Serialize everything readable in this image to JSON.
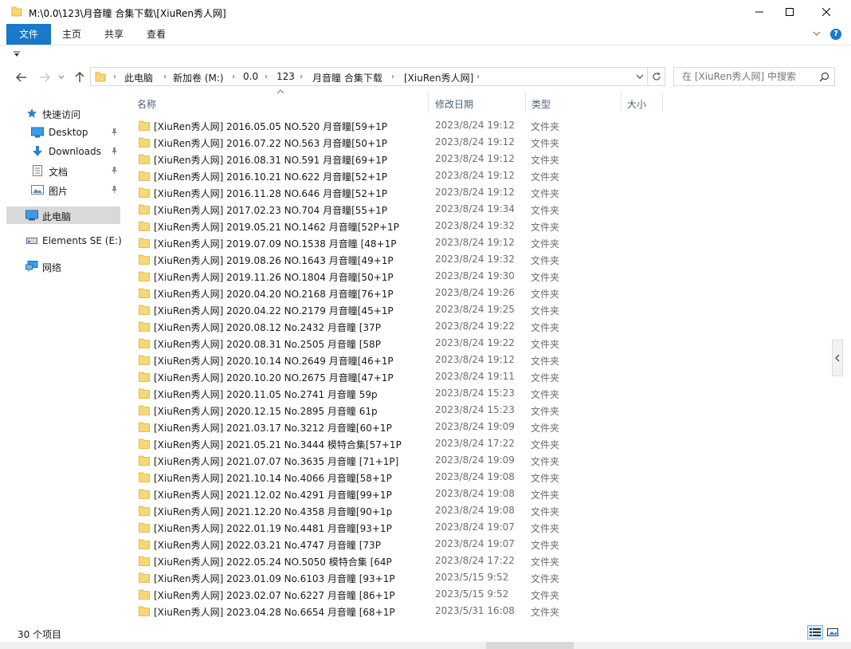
{
  "window": {
    "title": "M:\\0.0\\123\\月音瞳 合集下载\\[XiuRen秀人网]"
  },
  "ribbon": {
    "tabs": [
      "文件",
      "主页",
      "共享",
      "查看"
    ]
  },
  "address": {
    "crumbs": [
      "此电脑",
      "新加卷 (M:)",
      "0.0",
      "123",
      "月音瞳 合集下载",
      "[XiuRen秀人网]"
    ]
  },
  "search": {
    "placeholder": "在 [XiuRen秀人网] 中搜索"
  },
  "navpane": {
    "quick_access": "快速访问",
    "quick_items": [
      "Desktop",
      "Downloads",
      "文档",
      "图片"
    ],
    "this_pc": "此电脑",
    "drive": "Elements SE (E:)",
    "network": "网络"
  },
  "columns": {
    "name": "名称",
    "modified": "修改日期",
    "type": "类型",
    "size": "大小"
  },
  "files": [
    {
      "name": "[XiuRen秀人网] 2016.05.05 NO.520 月音瞳[59+1P",
      "date": "2023/8/24 19:12",
      "type": "文件夹"
    },
    {
      "name": "[XiuRen秀人网] 2016.07.22 NO.563 月音瞳[50+1P",
      "date": "2023/8/24 19:12",
      "type": "文件夹"
    },
    {
      "name": "[XiuRen秀人网] 2016.08.31 NO.591 月音瞳[69+1P",
      "date": "2023/8/24 19:12",
      "type": "文件夹"
    },
    {
      "name": "[XiuRen秀人网] 2016.10.21 NO.622 月音瞳[52+1P",
      "date": "2023/8/24 19:12",
      "type": "文件夹"
    },
    {
      "name": "[XiuRen秀人网] 2016.11.28 NO.646 月音瞳[52+1P",
      "date": "2023/8/24 19:12",
      "type": "文件夹"
    },
    {
      "name": "[XiuRen秀人网] 2017.02.23 NO.704 月音瞳[55+1P",
      "date": "2023/8/24 19:34",
      "type": "文件夹"
    },
    {
      "name": "[XiuRen秀人网] 2019.05.21 NO.1462 月音瞳[52P+1P",
      "date": "2023/8/24 19:32",
      "type": "文件夹"
    },
    {
      "name": "[XiuRen秀人网] 2019.07.09 NO.1538 月音瞳 [48+1P",
      "date": "2023/8/24 19:12",
      "type": "文件夹"
    },
    {
      "name": "[XiuRen秀人网] 2019.08.26 NO.1643 月音瞳[49+1P",
      "date": "2023/8/24 19:32",
      "type": "文件夹"
    },
    {
      "name": "[XiuRen秀人网] 2019.11.26 NO.1804 月音瞳[50+1P",
      "date": "2023/8/24 19:30",
      "type": "文件夹"
    },
    {
      "name": "[XiuRen秀人网] 2020.04.20 NO.2168 月音瞳[76+1P",
      "date": "2023/8/24 19:26",
      "type": "文件夹"
    },
    {
      "name": "[XiuRen秀人网] 2020.04.22 NO.2179 月音瞳[45+1P",
      "date": "2023/8/24 19:25",
      "type": "文件夹"
    },
    {
      "name": "[XiuRen秀人网] 2020.08.12 No.2432 月音瞳 [37P",
      "date": "2023/8/24 19:22",
      "type": "文件夹"
    },
    {
      "name": "[XiuRen秀人网] 2020.08.31 No.2505 月音瞳 [58P",
      "date": "2023/8/24 19:22",
      "type": "文件夹"
    },
    {
      "name": "[XiuRen秀人网] 2020.10.14 NO.2649 月音瞳[46+1P",
      "date": "2023/8/24 19:12",
      "type": "文件夹"
    },
    {
      "name": "[XiuRen秀人网] 2020.10.20 NO.2675 月音瞳[47+1P",
      "date": "2023/8/24 19:11",
      "type": "文件夹"
    },
    {
      "name": "[XiuRen秀人网] 2020.11.05 No.2741 月音瞳 59p",
      "date": "2023/8/24 15:23",
      "type": "文件夹"
    },
    {
      "name": "[XiuRen秀人网] 2020.12.15 No.2895 月音瞳 61p",
      "date": "2023/8/24 15:23",
      "type": "文件夹"
    },
    {
      "name": "[XiuRen秀人网] 2021.03.17 No.3212 月音瞳[60+1P",
      "date": "2023/8/24 19:09",
      "type": "文件夹"
    },
    {
      "name": "[XiuRen秀人网] 2021.05.21 No.3444 模特合集[57+1P",
      "date": "2023/8/24 17:22",
      "type": "文件夹"
    },
    {
      "name": "[XiuRen秀人网] 2021.07.07 No.3635 月音瞳 [71+1P]",
      "date": "2023/8/24 19:09",
      "type": "文件夹"
    },
    {
      "name": "[XiuRen秀人网] 2021.10.14 No.4066 月音瞳[58+1P",
      "date": "2023/8/24 19:08",
      "type": "文件夹"
    },
    {
      "name": "[XiuRen秀人网] 2021.12.02 No.4291 月音瞳[99+1P",
      "date": "2023/8/24 19:08",
      "type": "文件夹"
    },
    {
      "name": "[XiuRen秀人网] 2021.12.20 No.4358 月音瞳[90+1p",
      "date": "2023/8/24 19:08",
      "type": "文件夹"
    },
    {
      "name": "[XiuRen秀人网] 2022.01.19 No.4481 月音瞳[93+1P",
      "date": "2023/8/24 19:07",
      "type": "文件夹"
    },
    {
      "name": "[XiuRen秀人网] 2022.03.21 No.4747 月音瞳 [73P",
      "date": "2023/8/24 19:07",
      "type": "文件夹"
    },
    {
      "name": "[XiuRen秀人网] 2022.05.24 NO.5050 模特合集 [64P",
      "date": "2023/8/24 17:22",
      "type": "文件夹"
    },
    {
      "name": "[XiuRen秀人网] 2023.01.09 No.6103 月音瞳 [93+1P",
      "date": "2023/5/15 9:52",
      "type": "文件夹"
    },
    {
      "name": "[XiuRen秀人网] 2023.02.07 No.6227 月音瞳 [86+1P",
      "date": "2023/5/15 9:52",
      "type": "文件夹"
    },
    {
      "name": "[XiuRen秀人网] 2023.04.28 No.6654 月音瞳 [68+1P",
      "date": "2023/5/31 16:08",
      "type": "文件夹"
    }
  ],
  "status": {
    "item_count": "30 个项目"
  },
  "colors": {
    "accent": "#1979ca",
    "folder": "#f8d775",
    "header_text": "#4c607a",
    "secondary_text": "#6d6d6d"
  },
  "icons": {
    "folder": "folder-icon",
    "star": "quick-access-star-icon",
    "pin": "pin-icon",
    "pc": "computer-icon",
    "drive": "drive-icon",
    "network": "network-icon"
  }
}
